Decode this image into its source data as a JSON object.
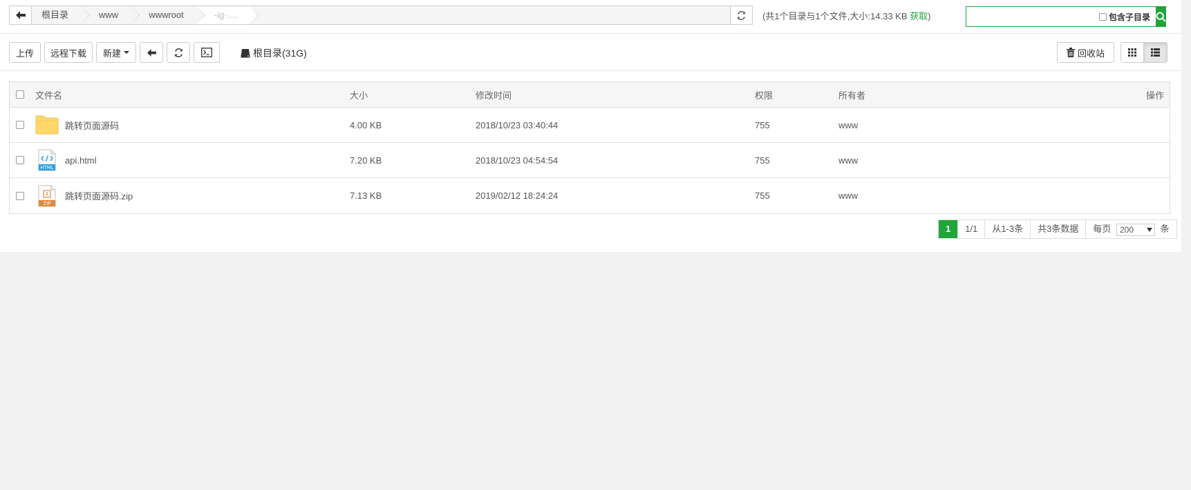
{
  "path": {
    "crumbs": [
      "根目录",
      "www",
      "wwwroot",
      "-ig·...."
    ]
  },
  "summary": {
    "text": "(共1个目录与1个文件,大小:14.33 KB",
    "fetch_label": "获取",
    "close": ")"
  },
  "search": {
    "placeholder": "",
    "include_subdir_label": "包含子目录"
  },
  "toolbar": {
    "upload_label": "上传",
    "remote_download_label": "远程下载",
    "new_label": "新建",
    "disk_label": "根目录(31G)",
    "recycle_label": "回收站"
  },
  "table": {
    "headers": {
      "name": "文件名",
      "size": "大小",
      "mtime": "修改时间",
      "perm": "权限",
      "owner": "所有者",
      "ops": "操作"
    },
    "rows": [
      {
        "name": "跳转页面源码",
        "icon": "folder-icon",
        "size": "4.00 KB",
        "mtime": "2018/10/23 03:40:44",
        "perm": "755",
        "owner": "www"
      },
      {
        "name": "api.html",
        "icon": "html-file-icon",
        "size": "7.20 KB",
        "mtime": "2018/10/23 04:54:54",
        "perm": "755",
        "owner": "www"
      },
      {
        "name": "跳转页面源码.zip",
        "icon": "zip-file-icon",
        "size": "7.13 KB",
        "mtime": "2019/02/12 18:24:24",
        "perm": "755",
        "owner": "www"
      }
    ]
  },
  "pagination": {
    "current": "1",
    "pages": "1/1",
    "range": "从1-3条",
    "total": "共3条数据",
    "per_page_label": "每页",
    "per_page_value": "200",
    "unit": "条"
  },
  "colors": {
    "accent": "#20a53a",
    "folder": "#ffd86b"
  }
}
